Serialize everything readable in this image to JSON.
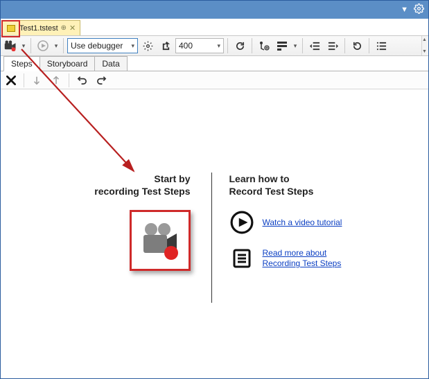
{
  "titlebar": {},
  "doctab": {
    "title": "Test1.tstest",
    "pin_glyph": "⊕",
    "close_glyph": "✕"
  },
  "toolbar": {
    "use_debugger_label": "Use debugger",
    "delay_value": "400"
  },
  "ctabs": {
    "steps": "Steps",
    "storyboard": "Storyboard",
    "data": "Data"
  },
  "left": {
    "line1": "Start by",
    "line2": "recording Test Steps"
  },
  "right": {
    "line1": "Learn how to",
    "line2": "Record Test Steps",
    "video_link": "Watch a video tutorial",
    "read_link": "Read more about Recording Test Steps"
  }
}
